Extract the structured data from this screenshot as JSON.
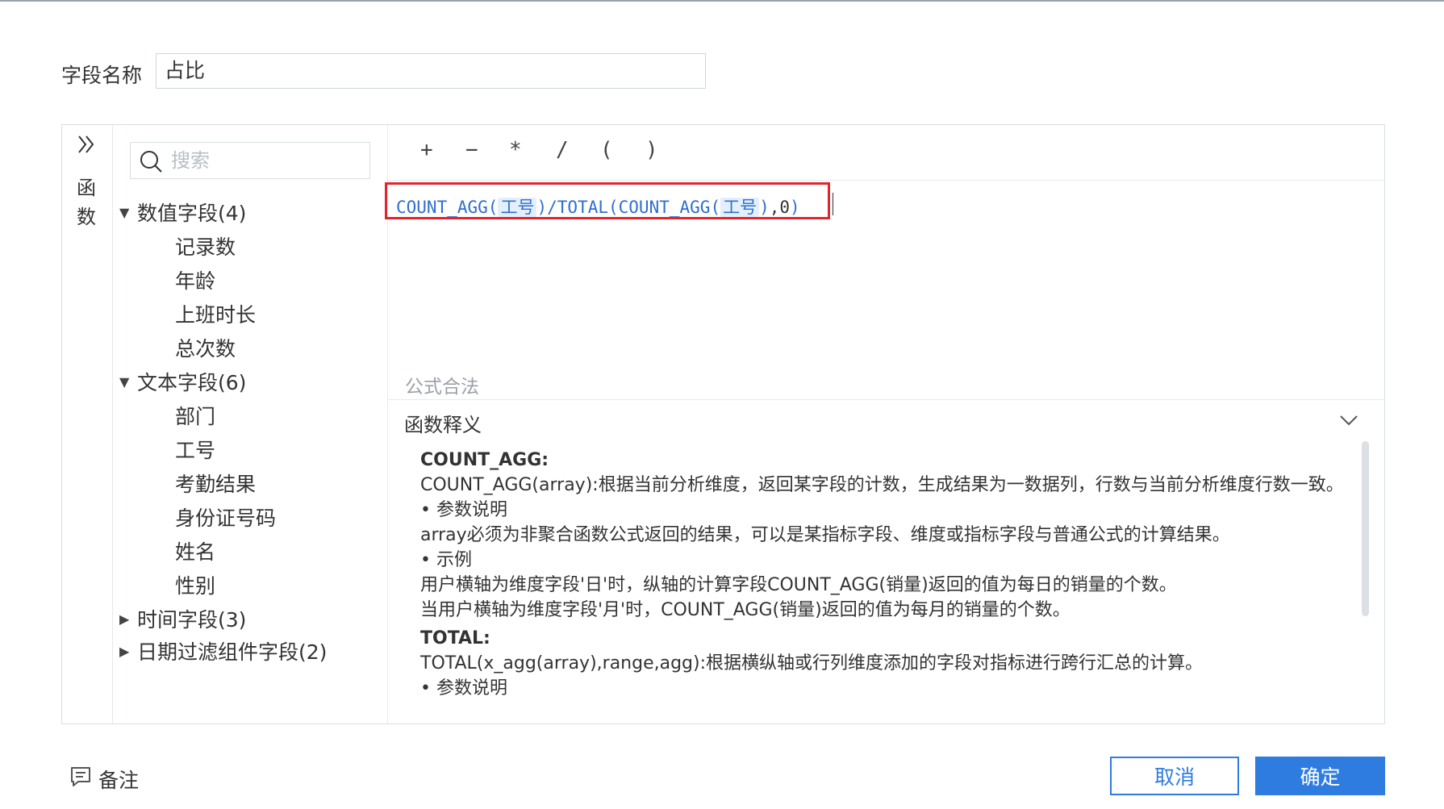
{
  "field_name": {
    "label": "字段名称",
    "value": "占比"
  },
  "rail": {
    "text_line1": "函",
    "text_line2": "数"
  },
  "search": {
    "placeholder": "搜索"
  },
  "tree": {
    "groups": [
      {
        "label": "数值字段(4)",
        "items": [
          "记录数",
          "年龄",
          "上班时长",
          "总次数"
        ]
      },
      {
        "label": "文本字段(6)",
        "items": [
          "部门",
          "工号",
          "考勤结果",
          "身份证号码",
          "姓名",
          "性别"
        ]
      },
      {
        "label": "时间字段(3)"
      },
      {
        "label": "日期过滤组件字段(2)"
      }
    ]
  },
  "operators": [
    "+",
    "−",
    "*",
    "/",
    "(",
    ")"
  ],
  "formula": {
    "fn1": "COUNT_AGG",
    "open1": "(",
    "arg1": "工号",
    "close1": ")",
    "slash": "/",
    "fn2": "TOTAL",
    "open2": "(",
    "fn3": "COUNT_AGG",
    "open3": "(",
    "arg2": "工号",
    "close3": ")",
    "comma_zero": ",0",
    "close2": ")"
  },
  "validation": "公式合法",
  "docs": {
    "title": "函数释义",
    "count_agg": {
      "name": "COUNT_AGG:",
      "desc": "COUNT_AGG(array):根据当前分析维度，返回某字段的计数，生成结果为一数据列，行数与当前分析维度行数一致。",
      "param_head": "• 参数说明",
      "param": "array必须为非聚合函数公式返回的结果，可以是某指标字段、维度或指标字段与普通公式的计算结果。",
      "example_head": "• 示例",
      "example1": "用户横轴为维度字段'日'时，纵轴的计算字段COUNT_AGG(销量)返回的值为每日的销量的个数。",
      "example2": "当用户横轴为维度字段'月'时，COUNT_AGG(销量)返回的值为每月的销量的个数。"
    },
    "total": {
      "name": "TOTAL:",
      "desc": "TOTAL(x_agg(array),range,agg):根据横纵轴或行列维度添加的字段对指标进行跨行汇总的计算。",
      "param_head": "• 参数说明"
    }
  },
  "footer": {
    "note": "备注",
    "cancel": "取消",
    "ok": "确定"
  },
  "colors": {
    "primary": "#2f7ce0",
    "highlight_border": "#e0262c",
    "function_blue": "#2f6fce"
  }
}
